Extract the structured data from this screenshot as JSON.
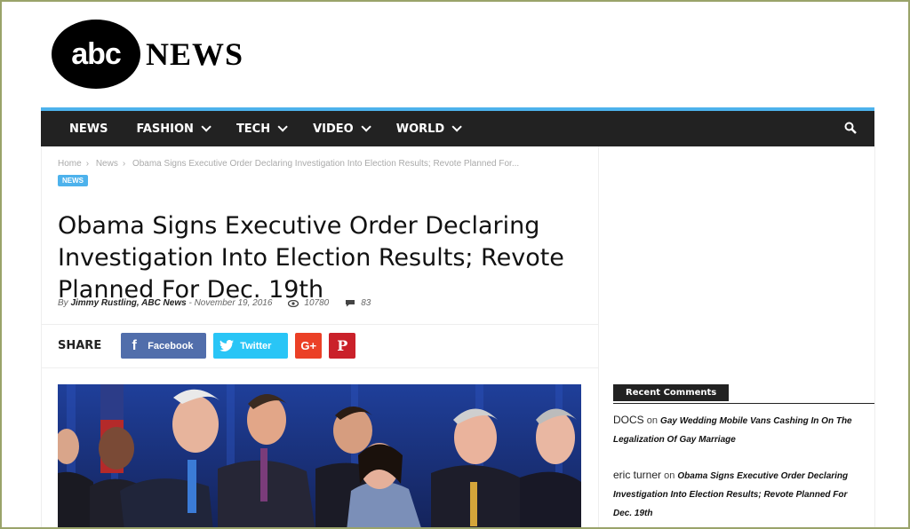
{
  "logo": {
    "circle_text": "abc",
    "news_text": "NEWS"
  },
  "nav": {
    "items": [
      {
        "label": "NEWS",
        "dropdown": false
      },
      {
        "label": "FASHION",
        "dropdown": true
      },
      {
        "label": "TECH",
        "dropdown": true
      },
      {
        "label": "VIDEO",
        "dropdown": true
      },
      {
        "label": "WORLD",
        "dropdown": true
      }
    ],
    "accent": "#4db2ec",
    "background": "#222222"
  },
  "breadcrumb": [
    "Home",
    "News",
    "Obama Signs Executive Order Declaring Investigation Into Election Results; Revote Planned For..."
  ],
  "category_badge": "NEWS",
  "article": {
    "title": "Obama Signs Executive Order Declaring Investigation Into Election Results; Revote Planned For Dec. 19th",
    "by": "By",
    "author": "Jimmy Rustling, ABC News",
    "date": "November 19, 2016",
    "views": "10780",
    "comments": "83"
  },
  "share": {
    "label": "SHARE",
    "facebook": "Facebook",
    "twitter": "Twitter",
    "googleplus": "G+",
    "pinterest": "P"
  },
  "sidebar": {
    "recent_comments_title": "Recent Comments",
    "comments": [
      {
        "author": "DOCS",
        "on": "on",
        "post": "Gay Wedding Mobile Vans Cashing In On The Legalization Of Gay Marriage"
      },
      {
        "author": "eric turner",
        "on": "on",
        "post": "Obama Signs Executive Order Declaring Investigation Into Election Results; Revote Planned For Dec. 19th"
      }
    ]
  }
}
